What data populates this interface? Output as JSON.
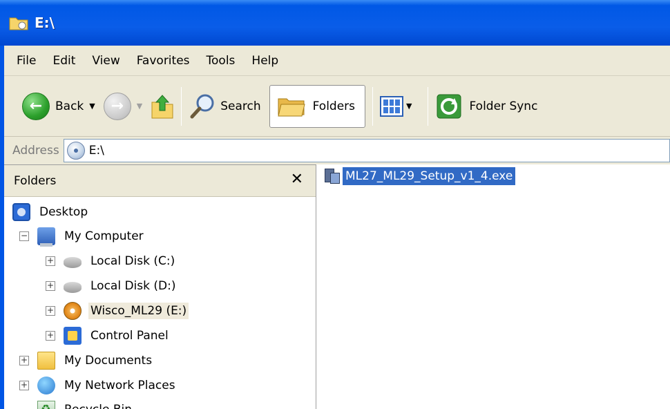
{
  "window": {
    "title": "E:\\"
  },
  "menu": [
    "File",
    "Edit",
    "View",
    "Favorites",
    "Tools",
    "Help"
  ],
  "toolbar": {
    "back_label": "Back",
    "search_label": "Search",
    "folders_label": "Folders",
    "folder_sync_label": "Folder Sync"
  },
  "address": {
    "label": "Address",
    "value": "E:\\"
  },
  "folders_pane": {
    "title": "Folders",
    "close_glyph": "✕",
    "tree": [
      {
        "label": "Desktop",
        "icon": "desktop-icon",
        "expander": ""
      },
      {
        "label": "My Computer",
        "icon": "my-computer-icon",
        "expander": "−"
      },
      {
        "label": "Local Disk (C:)",
        "icon": "hard-disk-icon",
        "expander": "+"
      },
      {
        "label": "Local Disk (D:)",
        "icon": "hard-disk-icon",
        "expander": "+"
      },
      {
        "label": "Wisco_ML29 (E:)",
        "icon": "cd-drive-icon",
        "expander": "+",
        "selected": true
      },
      {
        "label": "Control Panel",
        "icon": "control-panel-icon",
        "expander": "+"
      },
      {
        "label": "My Documents",
        "icon": "my-documents-icon",
        "expander": "+"
      },
      {
        "label": "My Network Places",
        "icon": "network-places-icon",
        "expander": "+"
      },
      {
        "label": "Recycle Bin",
        "icon": "recycle-bin-icon",
        "expander": ""
      }
    ]
  },
  "content": {
    "files": [
      {
        "name": "ML27_ML29_Setup_v1_4.exe",
        "icon": "setup-exe-icon",
        "selected": true
      }
    ]
  },
  "colors": {
    "titlebar": "#0058e6",
    "selection": "#316ac5",
    "chrome": "#ece9d8"
  }
}
